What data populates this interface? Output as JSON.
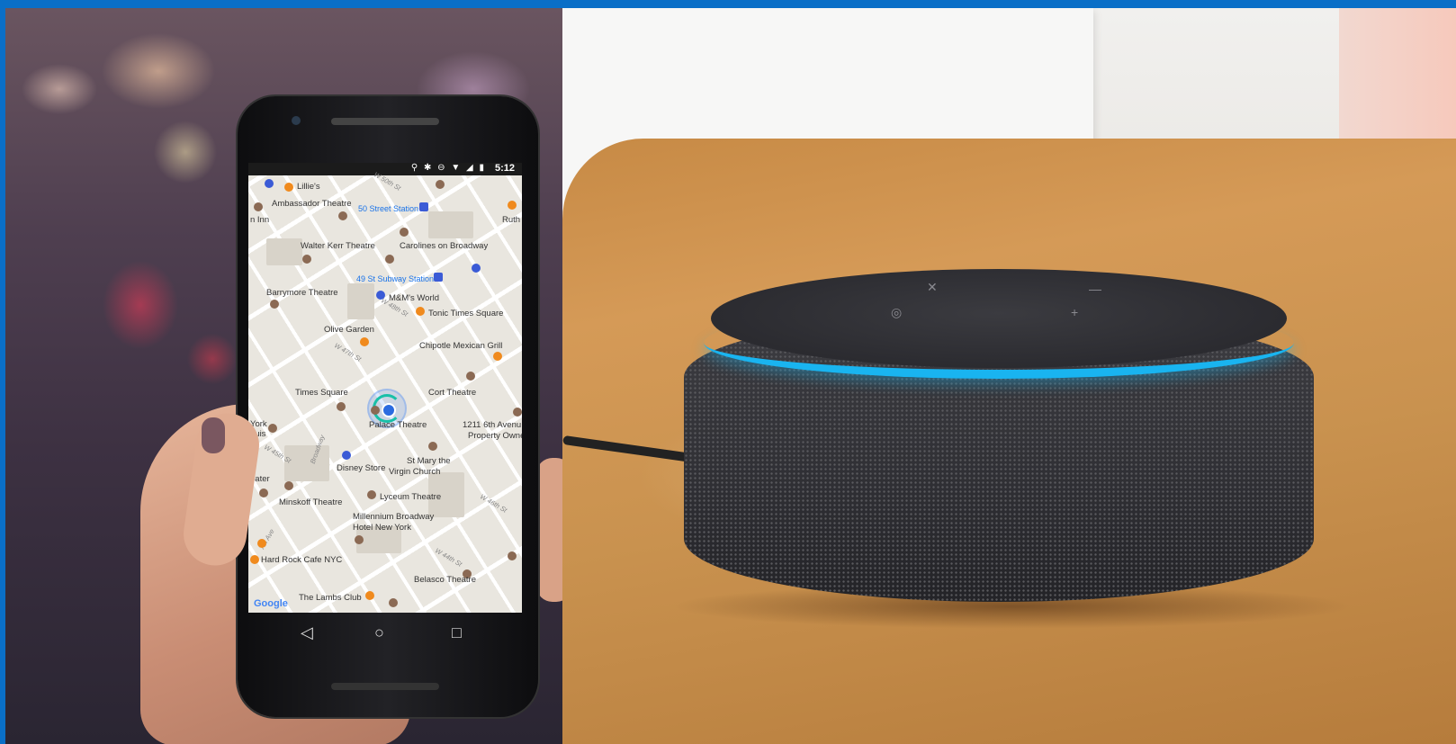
{
  "phone": {
    "status_time": "5:12",
    "status_icons": "⚲ ✱ ⊖ ▼ ◢ ▮",
    "google_logo": "Google",
    "map_labels": [
      "Lillie's",
      "Ambassador Theatre",
      "50 Street Station",
      "Walter Kerr Theatre",
      "Carolines on Broadway",
      "49 St Subway Station",
      "Barrymore Theatre",
      "M&M's World",
      "Tonic Times Square",
      "Olive Garden",
      "Chipotle Mexican Grill",
      "Times Square",
      "Cort Theatre",
      "Palace Theatre",
      "1211 6th Avenu",
      "Property Owne",
      "St Mary the",
      "Virgin Church",
      "Disney Store",
      "Minskoff Theatre",
      "Lyceum Theatre",
      "Millennium Broadway",
      "Hotel New York",
      "Hard Rock Cafe NYC",
      "Belasco Theatre",
      "The Lambs Club",
      "Ruth",
      "n Inn",
      "York",
      "quis",
      "eater"
    ],
    "street_labels": [
      "W 50th St",
      "W 48th St",
      "W 47th St",
      "W 46th St",
      "W 45th St",
      "W 44th St",
      "Broadway",
      "7th Ave"
    ],
    "nav": {
      "back": "◁",
      "home": "○",
      "recent": "□"
    }
  },
  "speaker": {
    "buttons": [
      "✕",
      "◎",
      "—",
      "+"
    ],
    "ring_color": "#19b4f0"
  }
}
